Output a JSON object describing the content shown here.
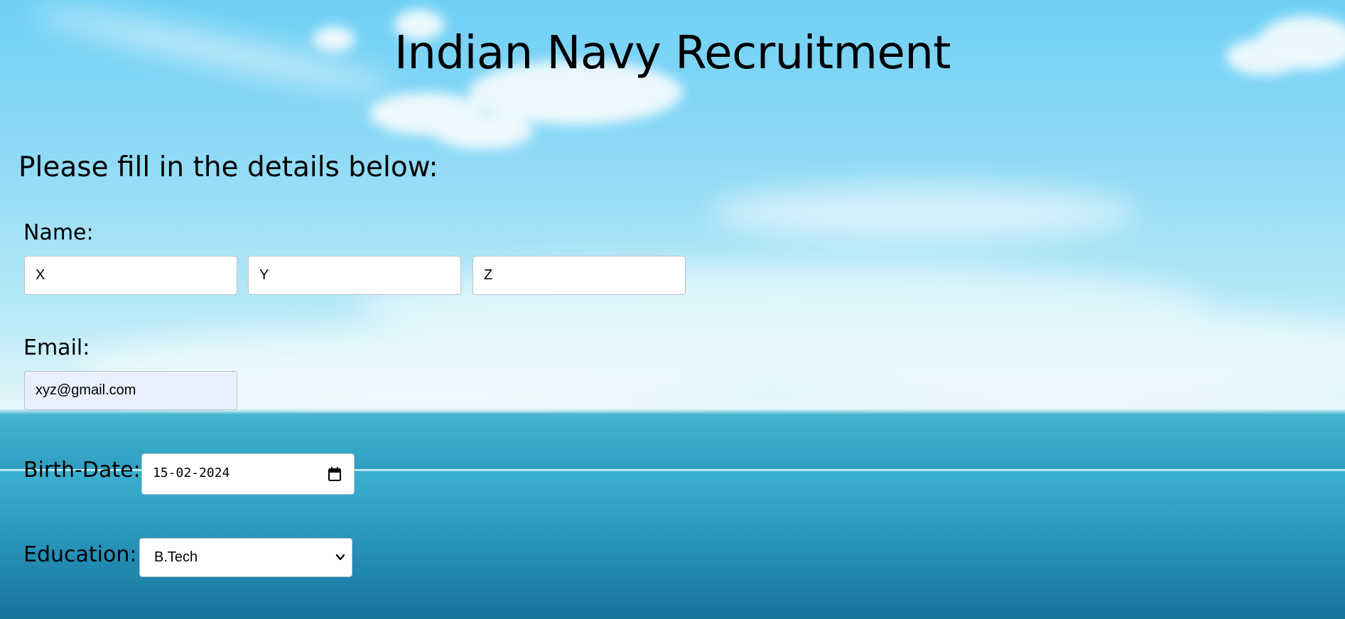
{
  "page": {
    "title": "Indian Navy Recruitment",
    "subtitle": "Please fill in the details below:"
  },
  "form": {
    "name": {
      "label": "Name:",
      "first": "X",
      "middle": "Y",
      "last": "Z"
    },
    "email": {
      "label": "Email:",
      "value": "xyz@gmail.com"
    },
    "birth_date": {
      "label": "Birth-Date:",
      "value": "15-02-2024",
      "icon": "calendar-icon"
    },
    "education": {
      "label": "Education:",
      "selected": "B.Tech",
      "icon": "chevron-down-icon"
    }
  },
  "colors": {
    "sky": "#8fdaf6",
    "sea": "#2796bb",
    "email_autofill_bg": "#e8f0fe"
  }
}
